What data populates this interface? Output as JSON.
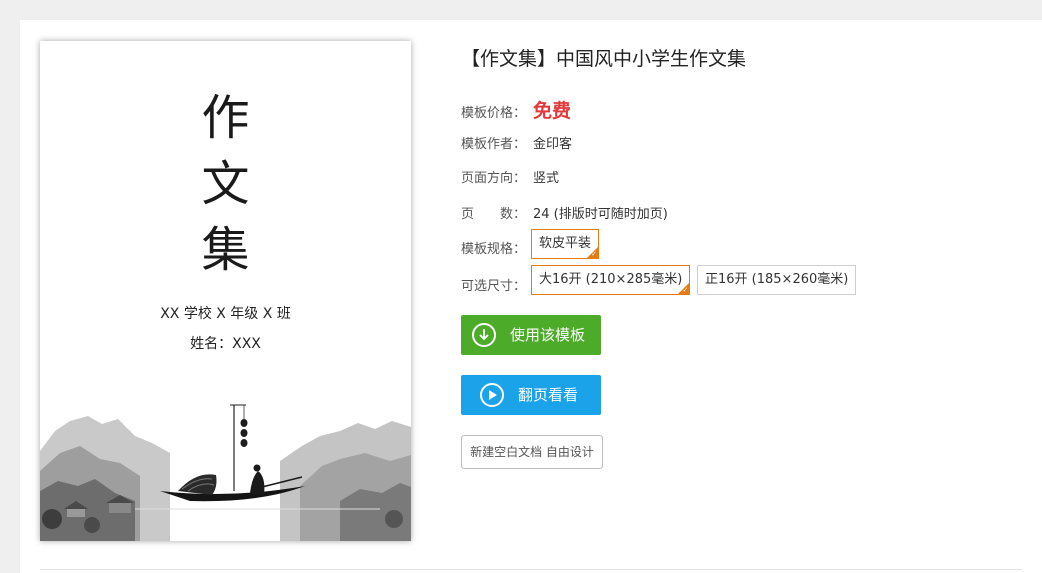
{
  "cover": {
    "title_chars": [
      "作",
      "文",
      "集"
    ],
    "school": "XX 学校 X 年级 X 班",
    "name": "姓名：XXX"
  },
  "product": {
    "title": "【作文集】中国风中小学生作文集",
    "price_label": "模板价格：",
    "price_value": "免费",
    "author_label": "模板作者：",
    "author_value": "金印客",
    "orientation_label": "页面方向：",
    "orientation_value": "竖式",
    "pages_label": "页　　数：",
    "pages_value": "24 (排版时可随时加页)",
    "spec_label": "模板规格：",
    "spec_options": [
      "软皮平装"
    ],
    "size_label": "可选尺寸：",
    "size_options": [
      "大16开 (210×285毫米)",
      "正16开 (185×260毫米)"
    ]
  },
  "actions": {
    "use_template": "使用该模板",
    "flip_preview": "翻页看看",
    "new_blank": "新建空白文档 自由设计"
  },
  "colors": {
    "price": "#e4393c",
    "selected_border": "#e57b12",
    "use_button": "#4dab2a",
    "preview_button": "#1aa3e8"
  },
  "icons": {
    "use_template": "download-circle-icon",
    "flip_preview": "play-circle-icon",
    "selected": "check-corner-icon"
  }
}
